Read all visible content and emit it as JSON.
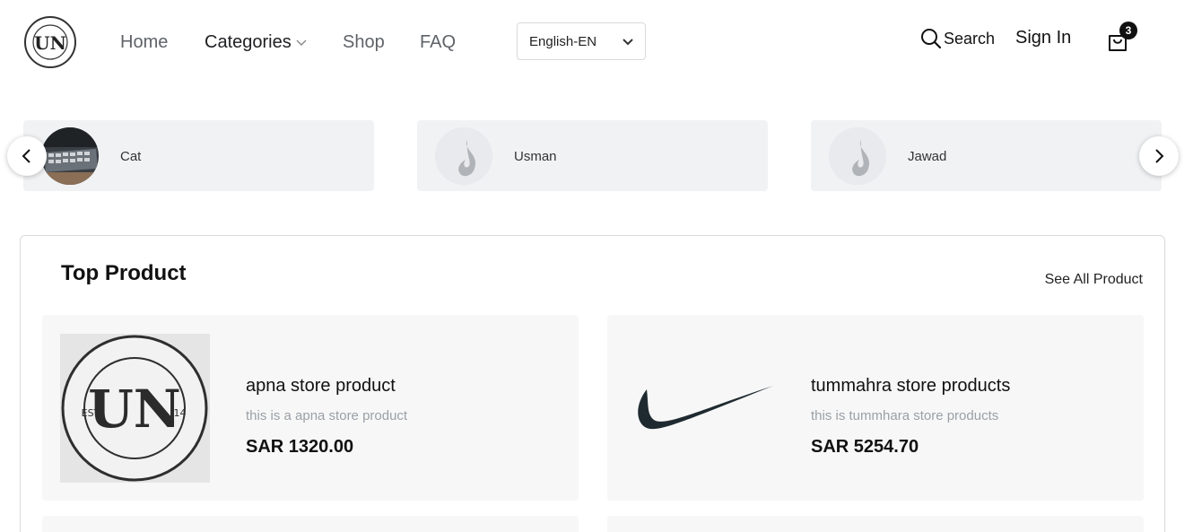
{
  "header": {
    "logo_icon": "urban-necessities-logo",
    "nav": [
      {
        "label": "Home"
      },
      {
        "label": "Categories"
      },
      {
        "label": "Shop"
      },
      {
        "label": "FAQ"
      }
    ],
    "language": "English-EN",
    "search_label": "Search",
    "signin_label": "Sign In",
    "cart_count": "3"
  },
  "stores": [
    {
      "name": "Cat",
      "avatar": "keyboard-photo"
    },
    {
      "name": "Usman",
      "avatar": "flame-placeholder-icon"
    },
    {
      "name": "Jawad",
      "avatar": "flame-placeholder-icon"
    }
  ],
  "top_product": {
    "title": "Top Product",
    "see_all": "See All Product",
    "products": [
      {
        "name": "apna store product",
        "description": "this is a apna store product",
        "price": "SAR 1320.00",
        "image": "urban-necessities-logo"
      },
      {
        "name": "tummahra store products",
        "description": "this is tummhara store products",
        "price": "SAR 5254.70",
        "image": "swoosh-logo"
      }
    ]
  },
  "colors": {
    "card_bg": "#f1f2f4",
    "product_bg": "#f7f7f7",
    "muted_text": "#9aa0a6",
    "badge_bg": "#111111"
  }
}
